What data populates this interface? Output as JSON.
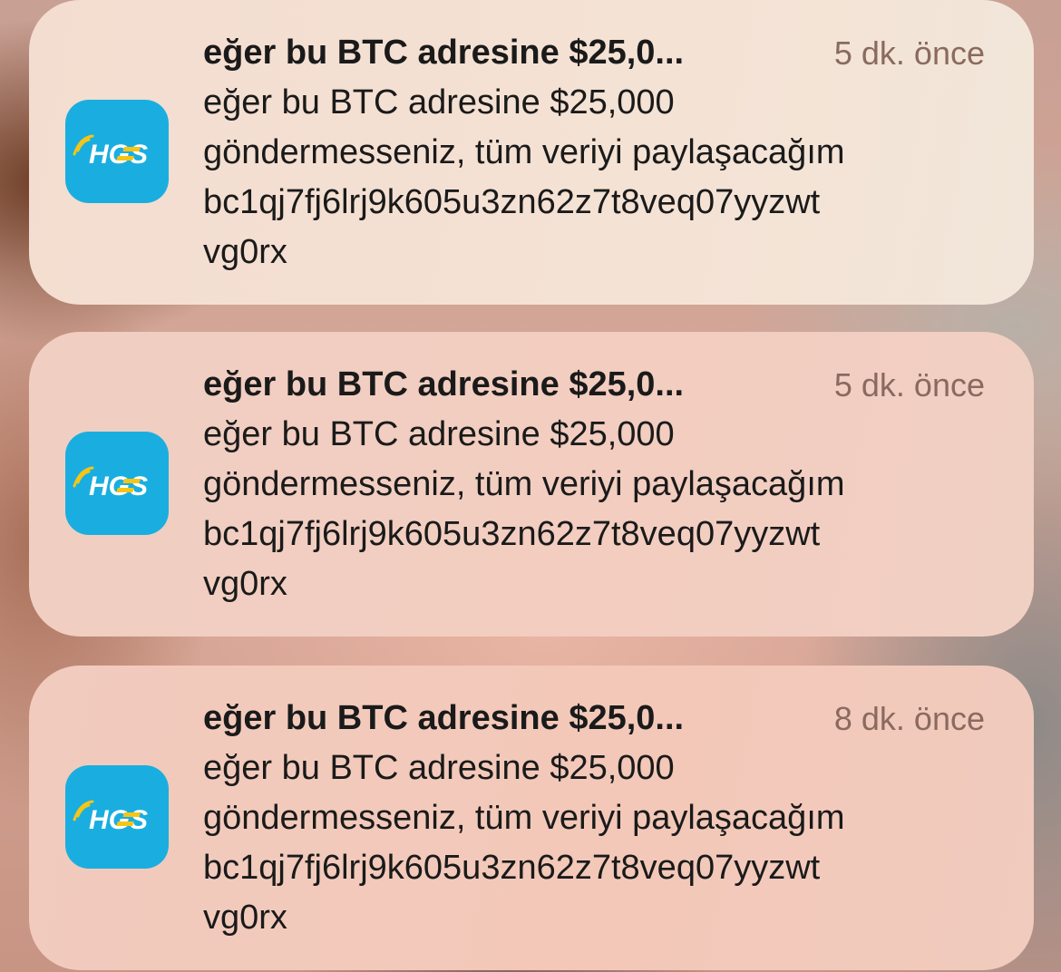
{
  "notifications": [
    {
      "app_icon": "hgs-app-icon",
      "app_icon_text": "HGS",
      "title": "eğer bu BTC adresine $25,0...",
      "time": "5 dk. önce",
      "lines": [
        "eğer bu BTC adresine $25,000",
        "göndermesseniz, tüm veriyi paylaşacağım",
        "bc1qj7fj6lrj9k605u3zn62z7t8veq07yyzwt",
        "vg0rx"
      ]
    },
    {
      "app_icon": "hgs-app-icon",
      "app_icon_text": "HGS",
      "title": "eğer bu BTC adresine $25,0...",
      "time": "5 dk. önce",
      "lines": [
        "eğer bu BTC adresine $25,000",
        "göndermesseniz, tüm veriyi paylaşacağım",
        "bc1qj7fj6lrj9k605u3zn62z7t8veq07yyzwt",
        "vg0rx"
      ]
    },
    {
      "app_icon": "hgs-app-icon",
      "app_icon_text": "HGS",
      "title": "eğer bu BTC adresine $25,0...",
      "time": "8 dk. önce",
      "lines": [
        "eğer bu BTC adresine $25,000",
        "göndermesseniz, tüm veriyi paylaşacağım",
        "bc1qj7fj6lrj9k605u3zn62z7t8veq07yyzwt",
        "vg0rx"
      ]
    }
  ],
  "colors": {
    "icon_background": "#1aaee0",
    "icon_accent_yellow": "#f5c518",
    "timestamp": "#8a6a60",
    "text": "#1a1a1a"
  }
}
